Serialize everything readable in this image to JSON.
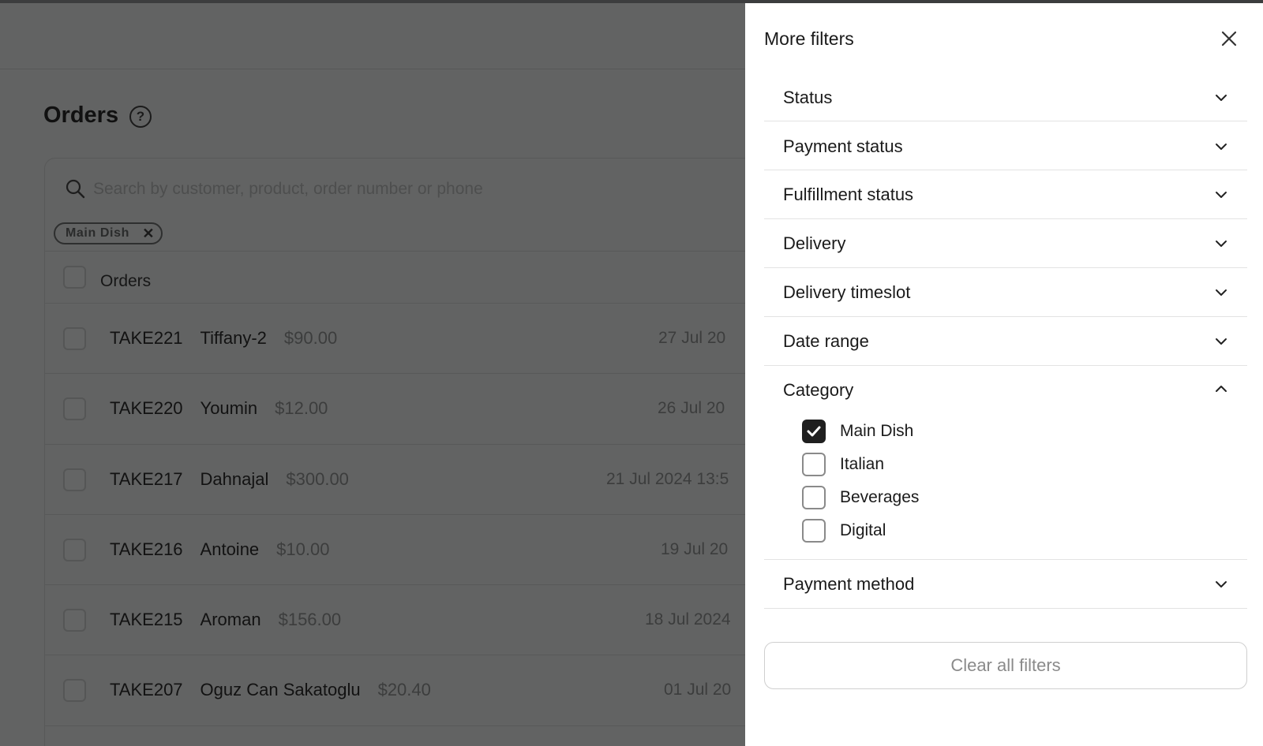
{
  "page": {
    "title": "Orders",
    "help_icon": "question-circle-icon",
    "search": {
      "placeholder": "Search by customer, product, order number or phone",
      "icon": "search-icon"
    },
    "active_chip": {
      "label": "Main Dish",
      "remove_icon": "close-icon"
    },
    "table_header": {
      "label": "Orders"
    },
    "orders": [
      {
        "number": "TAKE221",
        "customer": "Tiffany-2",
        "amount": "$90.00",
        "date": "27 Jul 20"
      },
      {
        "number": "TAKE220",
        "customer": "Youmin",
        "amount": "$12.00",
        "date": "26 Jul 20"
      },
      {
        "number": "TAKE217",
        "customer": "Dahnajal",
        "amount": "$300.00",
        "date": "21 Jul 2024 13:5"
      },
      {
        "number": "TAKE216",
        "customer": "Antoine",
        "amount": "$10.00",
        "date": "19 Jul 20"
      },
      {
        "number": "TAKE215",
        "customer": "Aroman",
        "amount": "$156.00",
        "date": "18 Jul 2024"
      },
      {
        "number": "TAKE207",
        "customer": "Oguz Can Sakatoglu",
        "amount": "$20.40",
        "date": "01 Jul 20"
      }
    ]
  },
  "drawer": {
    "title": "More filters",
    "close_icon": "close-icon",
    "sections": [
      {
        "label": "Status",
        "expanded": false
      },
      {
        "label": "Payment status",
        "expanded": false
      },
      {
        "label": "Fulfillment status",
        "expanded": false
      },
      {
        "label": "Delivery",
        "expanded": false
      },
      {
        "label": "Delivery timeslot",
        "expanded": false
      },
      {
        "label": "Date range",
        "expanded": false
      },
      {
        "label": "Category",
        "expanded": true
      },
      {
        "label": "Payment method",
        "expanded": false
      }
    ],
    "category_options": [
      {
        "label": "Main Dish",
        "checked": true
      },
      {
        "label": "Italian",
        "checked": false
      },
      {
        "label": "Beverages",
        "checked": false
      },
      {
        "label": "Digital",
        "checked": false
      }
    ],
    "clear_label": "Clear all filters"
  },
  "colors": {
    "overlay": "#626363",
    "drawer_bg": "#ffffff",
    "checkbox_checked": "#1f1f1f",
    "clear_text": "#8a8a8a"
  }
}
